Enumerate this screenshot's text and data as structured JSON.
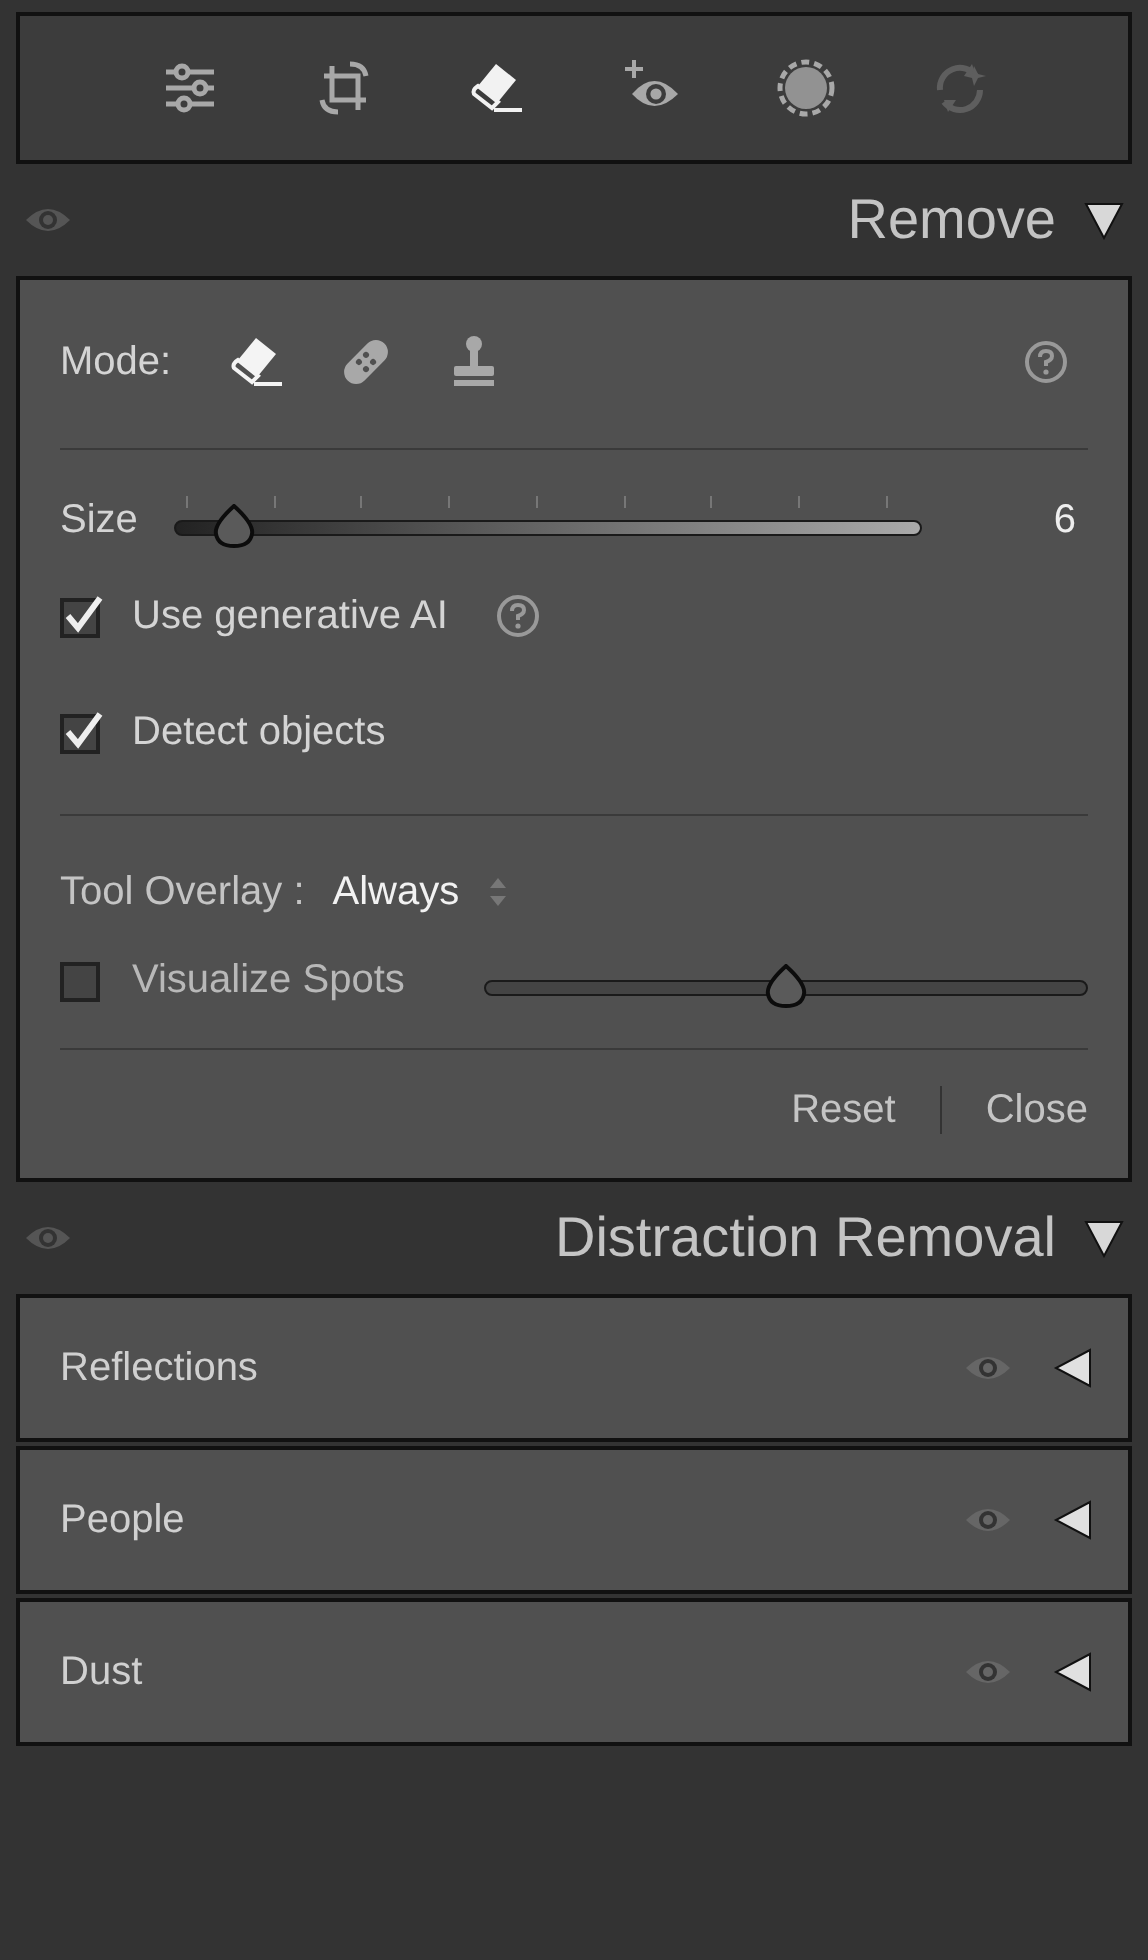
{
  "toolbar": {
    "tools": [
      {
        "selected": false,
        "disabled": false
      },
      {
        "selected": false,
        "disabled": false
      },
      {
        "selected": true,
        "disabled": false
      },
      {
        "selected": false,
        "disabled": false
      },
      {
        "selected": false,
        "disabled": false
      },
      {
        "selected": false,
        "disabled": true
      }
    ]
  },
  "remove": {
    "title": "Remove",
    "expanded": true,
    "mode": {
      "label": "Mode:",
      "options": [
        {
          "selected": true
        },
        {
          "selected": false
        },
        {
          "selected": false
        }
      ]
    },
    "size": {
      "label": "Size",
      "level": 0.08,
      "value": "6"
    },
    "checkboxes": [
      {
        "label": "Use generative AI",
        "checked": true,
        "help": true
      },
      {
        "label": "Detect objects",
        "checked": true,
        "help": false
      }
    ],
    "tool_overlay": {
      "label": "Tool Overlay :",
      "value": "Always"
    },
    "visualize": {
      "label": "Visualize Spots",
      "checked": false,
      "level": 0.5
    },
    "actions": [
      "Reset",
      "Close"
    ]
  },
  "distraction_removal": {
    "title": "Distraction Removal",
    "expanded": true,
    "items": [
      {
        "label": "Reflections",
        "expanded": false
      },
      {
        "label": "People",
        "expanded": false
      },
      {
        "label": "Dust",
        "expanded": false
      }
    ]
  }
}
